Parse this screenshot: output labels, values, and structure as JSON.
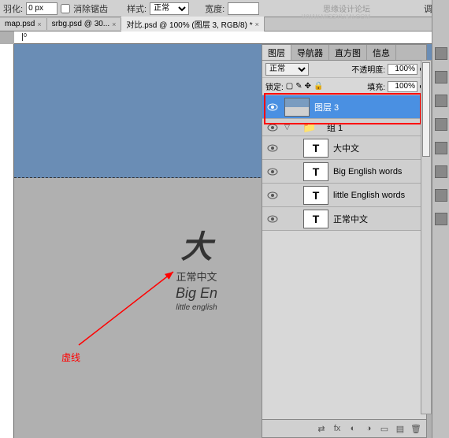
{
  "toolbar": {
    "feather_label": "羽化:",
    "feather_value": "0 px",
    "antialias_label": "消除锯齿",
    "style_label": "样式:",
    "style_value": "正常",
    "width_label": "宽度:",
    "adjust_label": "调整"
  },
  "watermark": "思缘设计论坛",
  "watermark_url": "WWW.MISSYUAN.COM",
  "doc_tabs": [
    {
      "label": "map.psd",
      "active": false
    },
    {
      "label": "srbg.psd @ 30...",
      "active": false
    },
    {
      "label": "对比.psd @ 100% (图层 3, RGB/8) *",
      "active": true
    }
  ],
  "panel_tabs": [
    "图层",
    "导航器",
    "直方图",
    "信息"
  ],
  "panel": {
    "blend_mode": "正常",
    "opacity_label": "不透明度:",
    "opacity_value": "100%",
    "lock_label": "锁定:",
    "fill_label": "填充:",
    "fill_value": "100%"
  },
  "layers": [
    {
      "name": "图层 3",
      "type": "image",
      "selected": true
    },
    {
      "name": "组 1",
      "type": "group",
      "selected": false
    },
    {
      "name": "大中文",
      "type": "text",
      "selected": false,
      "indent": true
    },
    {
      "name": "Big English words",
      "type": "text",
      "selected": false,
      "indent": true
    },
    {
      "name": "little English words",
      "type": "text",
      "selected": false,
      "indent": true
    },
    {
      "name": "正常中文",
      "type": "text",
      "selected": false,
      "indent": true
    }
  ],
  "canvas": {
    "big": "大",
    "norm_cn": "正常中文",
    "big_en": "Big En",
    "little_en": "little english"
  },
  "annotation": "虚线",
  "ruler_marks": [
    "0"
  ]
}
